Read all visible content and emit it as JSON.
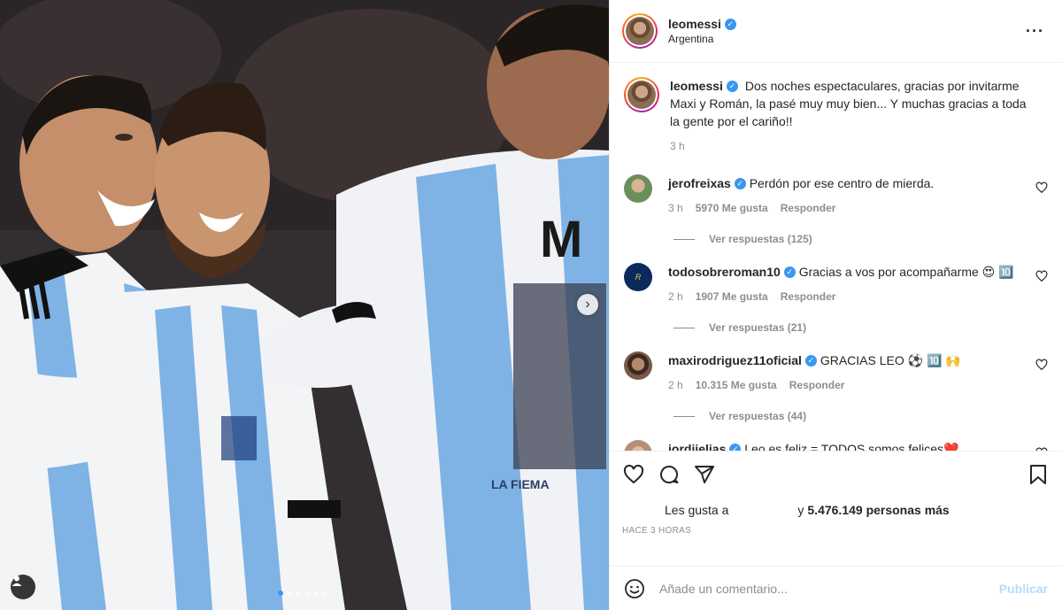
{
  "post": {
    "username": "leomessi",
    "location": "Argentina",
    "more_icon": "more-horizontal-icon",
    "caption": "Dos noches espectaculares, gracias por invitarme Maxi y Román, la pasé muy muy bien... Y muchas gracias a toda la gente por el cariño!!",
    "caption_time": "3 h"
  },
  "photo": {
    "jersey_text": "MRT",
    "shirt_text": "LA FIEMA",
    "next_icon": "chevron-right-icon",
    "tag_icon": "user-tag-icon",
    "carousel_count": 6,
    "carousel_active": 0
  },
  "comments": [
    {
      "username": "jerofreixas",
      "text": "Perdón por ese centro de mierda.",
      "time": "3 h",
      "likes": "5970 Me gusta",
      "reply": "Responder",
      "view_replies": "Ver respuestas (125)",
      "avatar_color": "#6b8f5a"
    },
    {
      "username": "todosobreroman10",
      "text": "Gracias a vos por acompañarme 😍 🔟",
      "time": "2 h",
      "likes": "1907 Me gusta",
      "reply": "Responder",
      "view_replies": "Ver respuestas (21)",
      "avatar_color": "#0b2a5c"
    },
    {
      "username": "maxirodriguez11oficial",
      "text": "GRACIAS LEO ⚽ 🔟 🙌",
      "time": "2 h",
      "likes": "10.315 Me gusta",
      "reply": "Responder",
      "view_replies": "Ver respuestas (44)",
      "avatar_color": "#5a3b2a"
    },
    {
      "username": "jordiielias",
      "text": "Leo es feliz = TODOS somos felices❤️",
      "time": "",
      "likes": "",
      "reply": "",
      "view_replies": "",
      "avatar_color": "#b88e76"
    }
  ],
  "actions": {
    "like_icon": "heart-icon",
    "comment_icon": "comment-icon",
    "share_icon": "send-icon",
    "save_icon": "bookmark-icon",
    "likes_prefix": "Les gusta a",
    "likes_and": "y",
    "likes_count": "5.476.149 personas más",
    "time_ago": "HACE 3 HORAS"
  },
  "add_comment": {
    "emoji_icon": "emoji-icon",
    "placeholder": "Añade un comentario...",
    "publish": "Publicar"
  },
  "colors": {
    "accent": "#3897f0",
    "publish_disabled": "#b3dbff",
    "muted": "#8e8e8e"
  }
}
